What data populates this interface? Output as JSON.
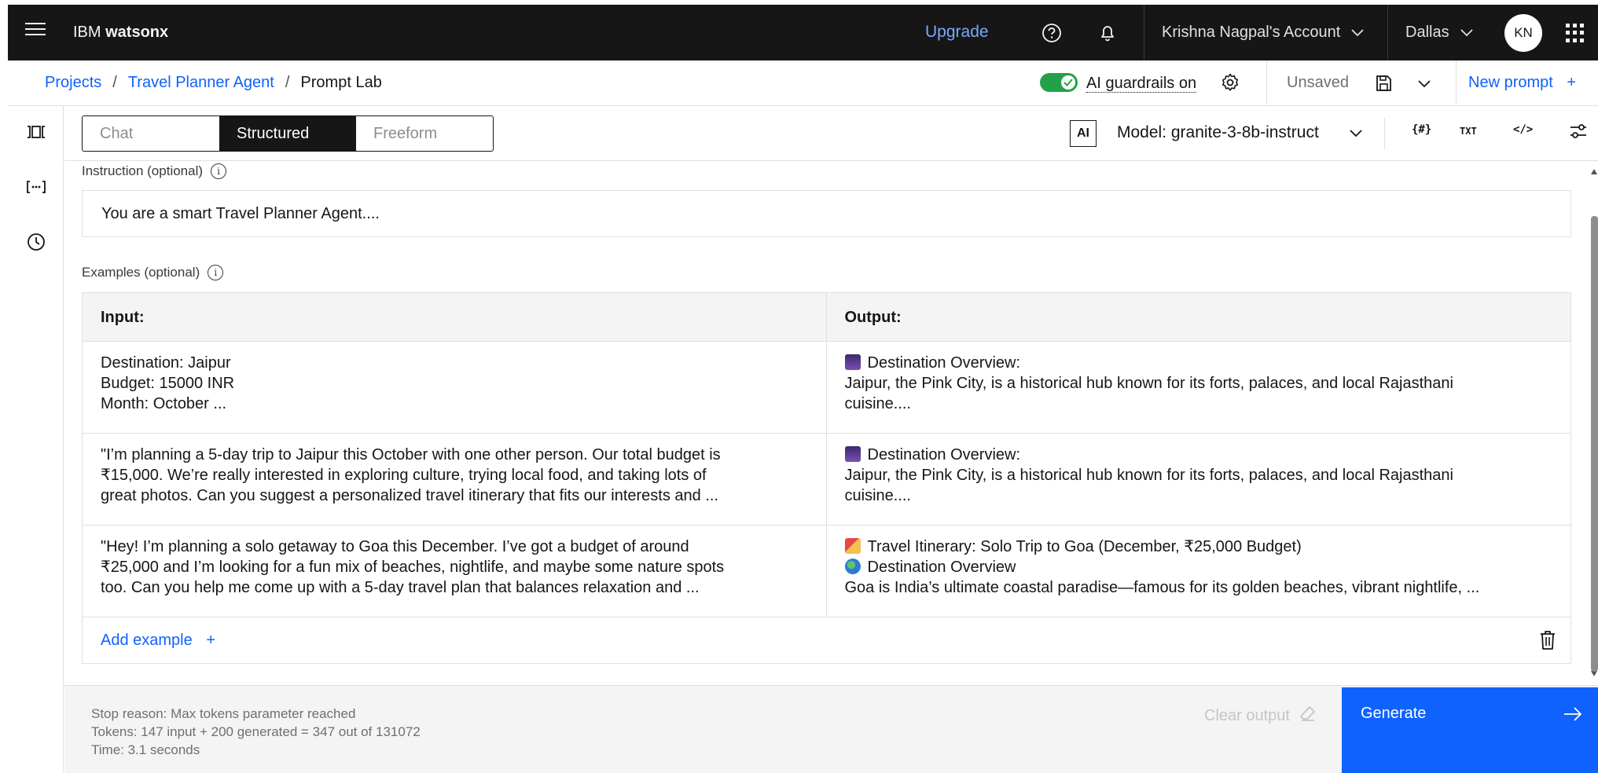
{
  "header": {
    "brand_prefix": "IBM",
    "brand_name": "watsonx",
    "upgrade": "Upgrade",
    "account": "Krishna Nagpal's Account",
    "region": "Dallas",
    "avatar_initials": "KN"
  },
  "subbar": {
    "breadcrumb": [
      "Projects",
      "Travel Planner Agent",
      "Prompt Lab"
    ],
    "guardrails_label": "AI guardrails on",
    "guardrails_on": true,
    "save_status": "Unsaved",
    "new_prompt": "New prompt"
  },
  "mode_tabs": [
    {
      "label": "Chat",
      "active": false
    },
    {
      "label": "Structured",
      "active": true
    },
    {
      "label": "Freeform",
      "active": false
    }
  ],
  "toolbar": {
    "ai_badge": "AI",
    "model": "Model: granite-3-8b-instruct",
    "tools": [
      "{#}",
      "TXT",
      "</>"
    ]
  },
  "instruction": {
    "label": "Instruction (optional)",
    "value": "You are a smart Travel Planner Agent...."
  },
  "examples": {
    "label": "Examples (optional)",
    "input_header": "Input:",
    "output_header": "Output:",
    "rows": [
      {
        "input": [
          "Destination: Jaipur",
          "Budget: 15000 INR",
          "Month: October  ..."
        ],
        "output": [
          "Destination Overview:",
          "Jaipur, the Pink City, is a historical hub known for its forts, palaces, and local Rajasthani",
          "cuisine...."
        ],
        "output_icons": [
          "city-night-emoji-icon"
        ]
      },
      {
        "input": [
          "\"I’m planning a 5-day trip to Jaipur this October with one other person. Our total budget is",
          "₹15,000. We’re really interested in exploring culture, trying local food, and taking lots of",
          "great photos. Can you suggest a personalized travel itinerary that fits our interests and ..."
        ],
        "output": [
          "Destination Overview:",
          "Jaipur, the Pink City, is a historical hub known for its forts, palaces, and local Rajasthani",
          "cuisine...."
        ],
        "output_icons": [
          "city-night-emoji-icon"
        ]
      },
      {
        "input": [
          "\"Hey! I’m planning a solo getaway to Goa this December. I’ve got a budget of around",
          "₹25,000 and I’m looking for a fun mix of beaches, nightlife, and maybe some nature spots",
          "too. Can you help me come up with a 5-day travel plan that balances relaxation and ..."
        ],
        "output": [
          "Travel Itinerary: Solo Trip to Goa (December, ₹25,000 Budget)",
          "Destination Overview",
          "Goa is India’s ultimate coastal paradise—famous for its golden beaches, vibrant nightlife, ..."
        ],
        "output_icons": [
          "beach-umbrella-emoji-icon",
          "globe-emoji-icon"
        ]
      }
    ],
    "add_label": "Add example"
  },
  "footer": {
    "stop_reason": "Stop reason: Max tokens parameter reached",
    "tokens": "Tokens: 147 input + 200 generated = 347 out of 131072",
    "time": "Time: 3.1 seconds",
    "clear_output": "Clear output",
    "generate": "Generate"
  },
  "colors": {
    "topbar": "#161616",
    "accent": "#0f62fe",
    "toggle_on": "#24a148"
  }
}
